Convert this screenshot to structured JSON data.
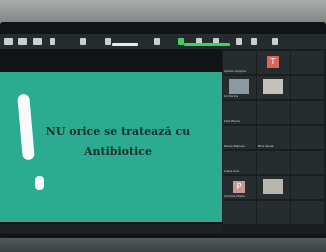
{
  "slide": {
    "title_line1": "NU orice se tratează cu",
    "title_line2": "Antibiotice"
  },
  "participants": [
    {
      "name": "Adrian Grigore",
      "avatar": ""
    },
    {
      "name": "",
      "avatar": "T"
    },
    {
      "name": "IA Viorica",
      "avatar": ""
    },
    {
      "name": "",
      "avatar": ""
    },
    {
      "name": "Clas Elena",
      "avatar": ""
    },
    {
      "name": "",
      "avatar": ""
    },
    {
      "name": "Diana Blanaru",
      "avatar": ""
    },
    {
      "name": "Bica Paula",
      "avatar": ""
    },
    {
      "name": "Ioana Ana",
      "avatar": ""
    },
    {
      "name": "",
      "avatar": ""
    },
    {
      "name": "",
      "avatar": ""
    },
    {
      "name": "",
      "avatar": ""
    },
    {
      "name": "Cristina Matei",
      "avatar": "P"
    },
    {
      "name": "",
      "avatar": ""
    },
    {
      "name": "",
      "avatar": ""
    }
  ],
  "colors": {
    "slide_bg": "#2bab8f",
    "accent_green": "#3fd25c",
    "accent_red": "#d9665a"
  }
}
